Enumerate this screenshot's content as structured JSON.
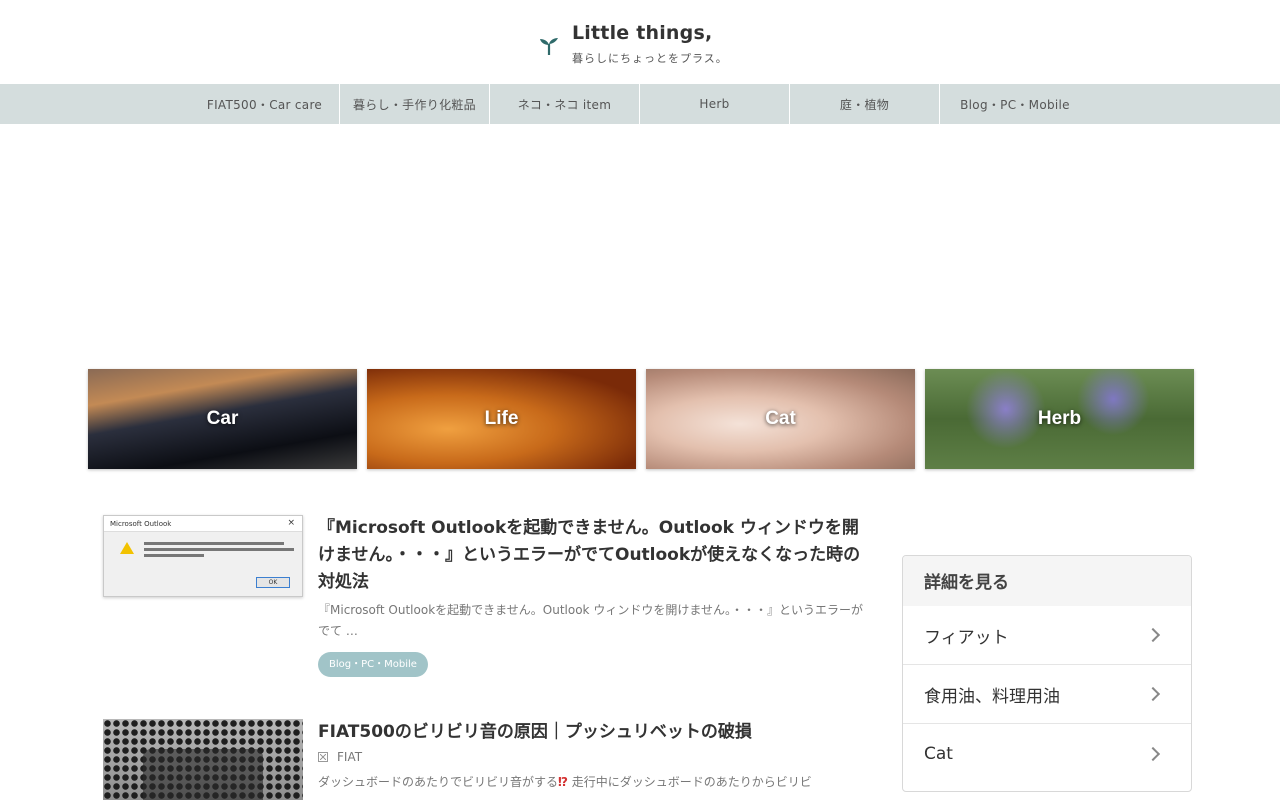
{
  "site": {
    "title": "Little things,",
    "tagline": "暮らしにちょっとをプラス。"
  },
  "nav": {
    "items": [
      "FIAT500・Car care",
      "暮らし・手作り化粧品",
      "ネコ・ネコ item",
      "Herb",
      "庭・植物",
      "Blog・PC・Mobile"
    ]
  },
  "tiles": {
    "car": "Car",
    "life": "Life",
    "cat": "Cat",
    "herb": "Herb"
  },
  "posts": [
    {
      "title": "『Microsoft Outlookを起動できません。Outlook ウィンドウを開けません。・・・』というエラーがでてOutlookが使えなくなった時の対処法",
      "excerpt": "『Microsoft Outlookを起動できません。Outlook ウィンドウを開けません。・・・』というエラーがでて …",
      "tag": "Blog・PC・Mobile",
      "thumb": {
        "dialog_title": "Microsoft Outlook",
        "close": "×",
        "ok": "OK"
      }
    },
    {
      "title": "FIAT500のビリビリ音の原因｜プッシュリベットの破損",
      "category": "FIAT",
      "excerpt_before": "ダッシュボードのあたりでビリビリ音がする",
      "excerpt_mark": "⁉",
      "excerpt_after": " 走行中にダッシュボードのあたりからビリビ"
    }
  ],
  "sidebar": {
    "heading": "詳細を見る",
    "items": [
      "フィアット",
      "食用油、料理用油",
      "Cat"
    ]
  },
  "colors": {
    "nav_bg": "#d4dddd",
    "tag_bg": "#a1c4c8",
    "sprout": "#2f6a6a"
  }
}
